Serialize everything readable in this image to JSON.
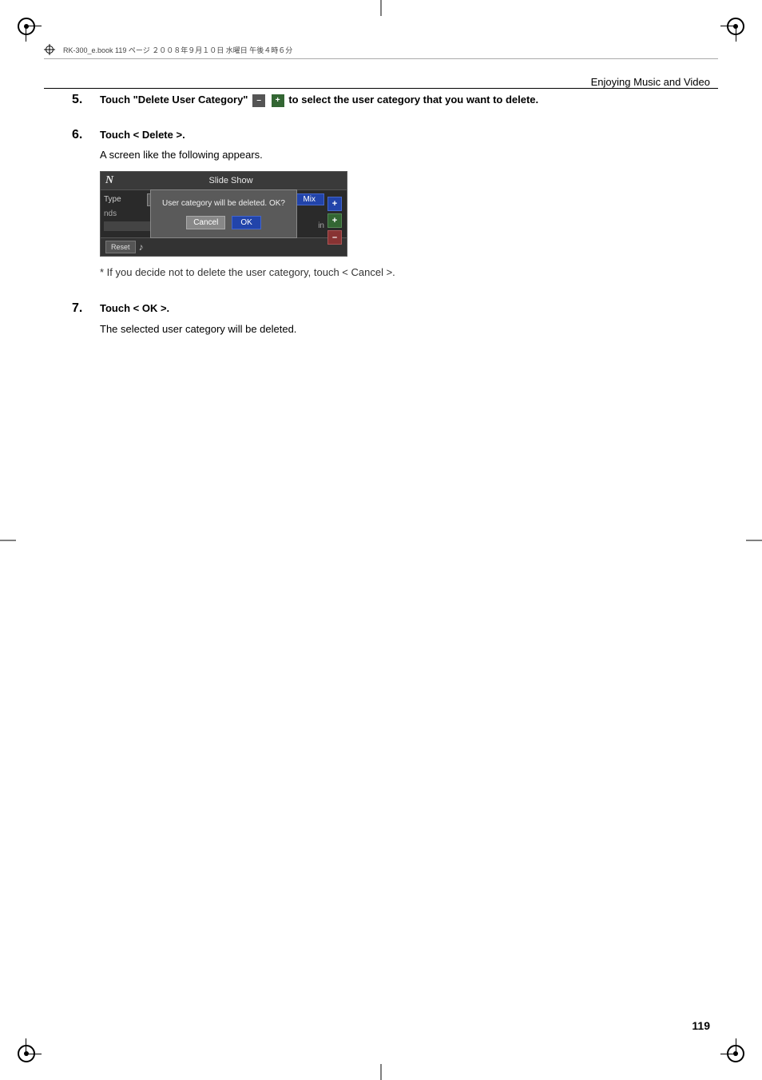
{
  "page": {
    "title": "Enjoying Music and Video",
    "number": "119",
    "header_filename": "RK-300_e.book  119 ページ  ２００８年９月１０日  水曜日  午後４時６分"
  },
  "steps": {
    "step5": {
      "number": "5.",
      "text_before": "Touch \"Delete User Category\"",
      "btn_minus": "–",
      "btn_plus": "+",
      "text_after": "to select the user category that you want to delete."
    },
    "step6": {
      "number": "6.",
      "label": "Touch < Delete >.",
      "sub_label": "A screen like the following appears."
    },
    "step7": {
      "number": "7.",
      "label": "Touch < OK >.",
      "sub_label": "The selected user category will be deleted."
    }
  },
  "screenshot": {
    "logo": "N",
    "title": "Slide Show",
    "row1_label": "Type",
    "row1_val": "Mix",
    "row2_val": "nds",
    "dialog_text": "User category will be deleted. OK?",
    "dialog_cancel": "Cancel",
    "dialog_ok": "OK",
    "footer_reset": "Reset",
    "side_btns": [
      "+",
      "+",
      "–"
    ],
    "row3_val": "in"
  },
  "note": "* If you decide not to delete the user category, touch < Cancel >.",
  "icons": {
    "minus": "–",
    "plus": "+"
  }
}
